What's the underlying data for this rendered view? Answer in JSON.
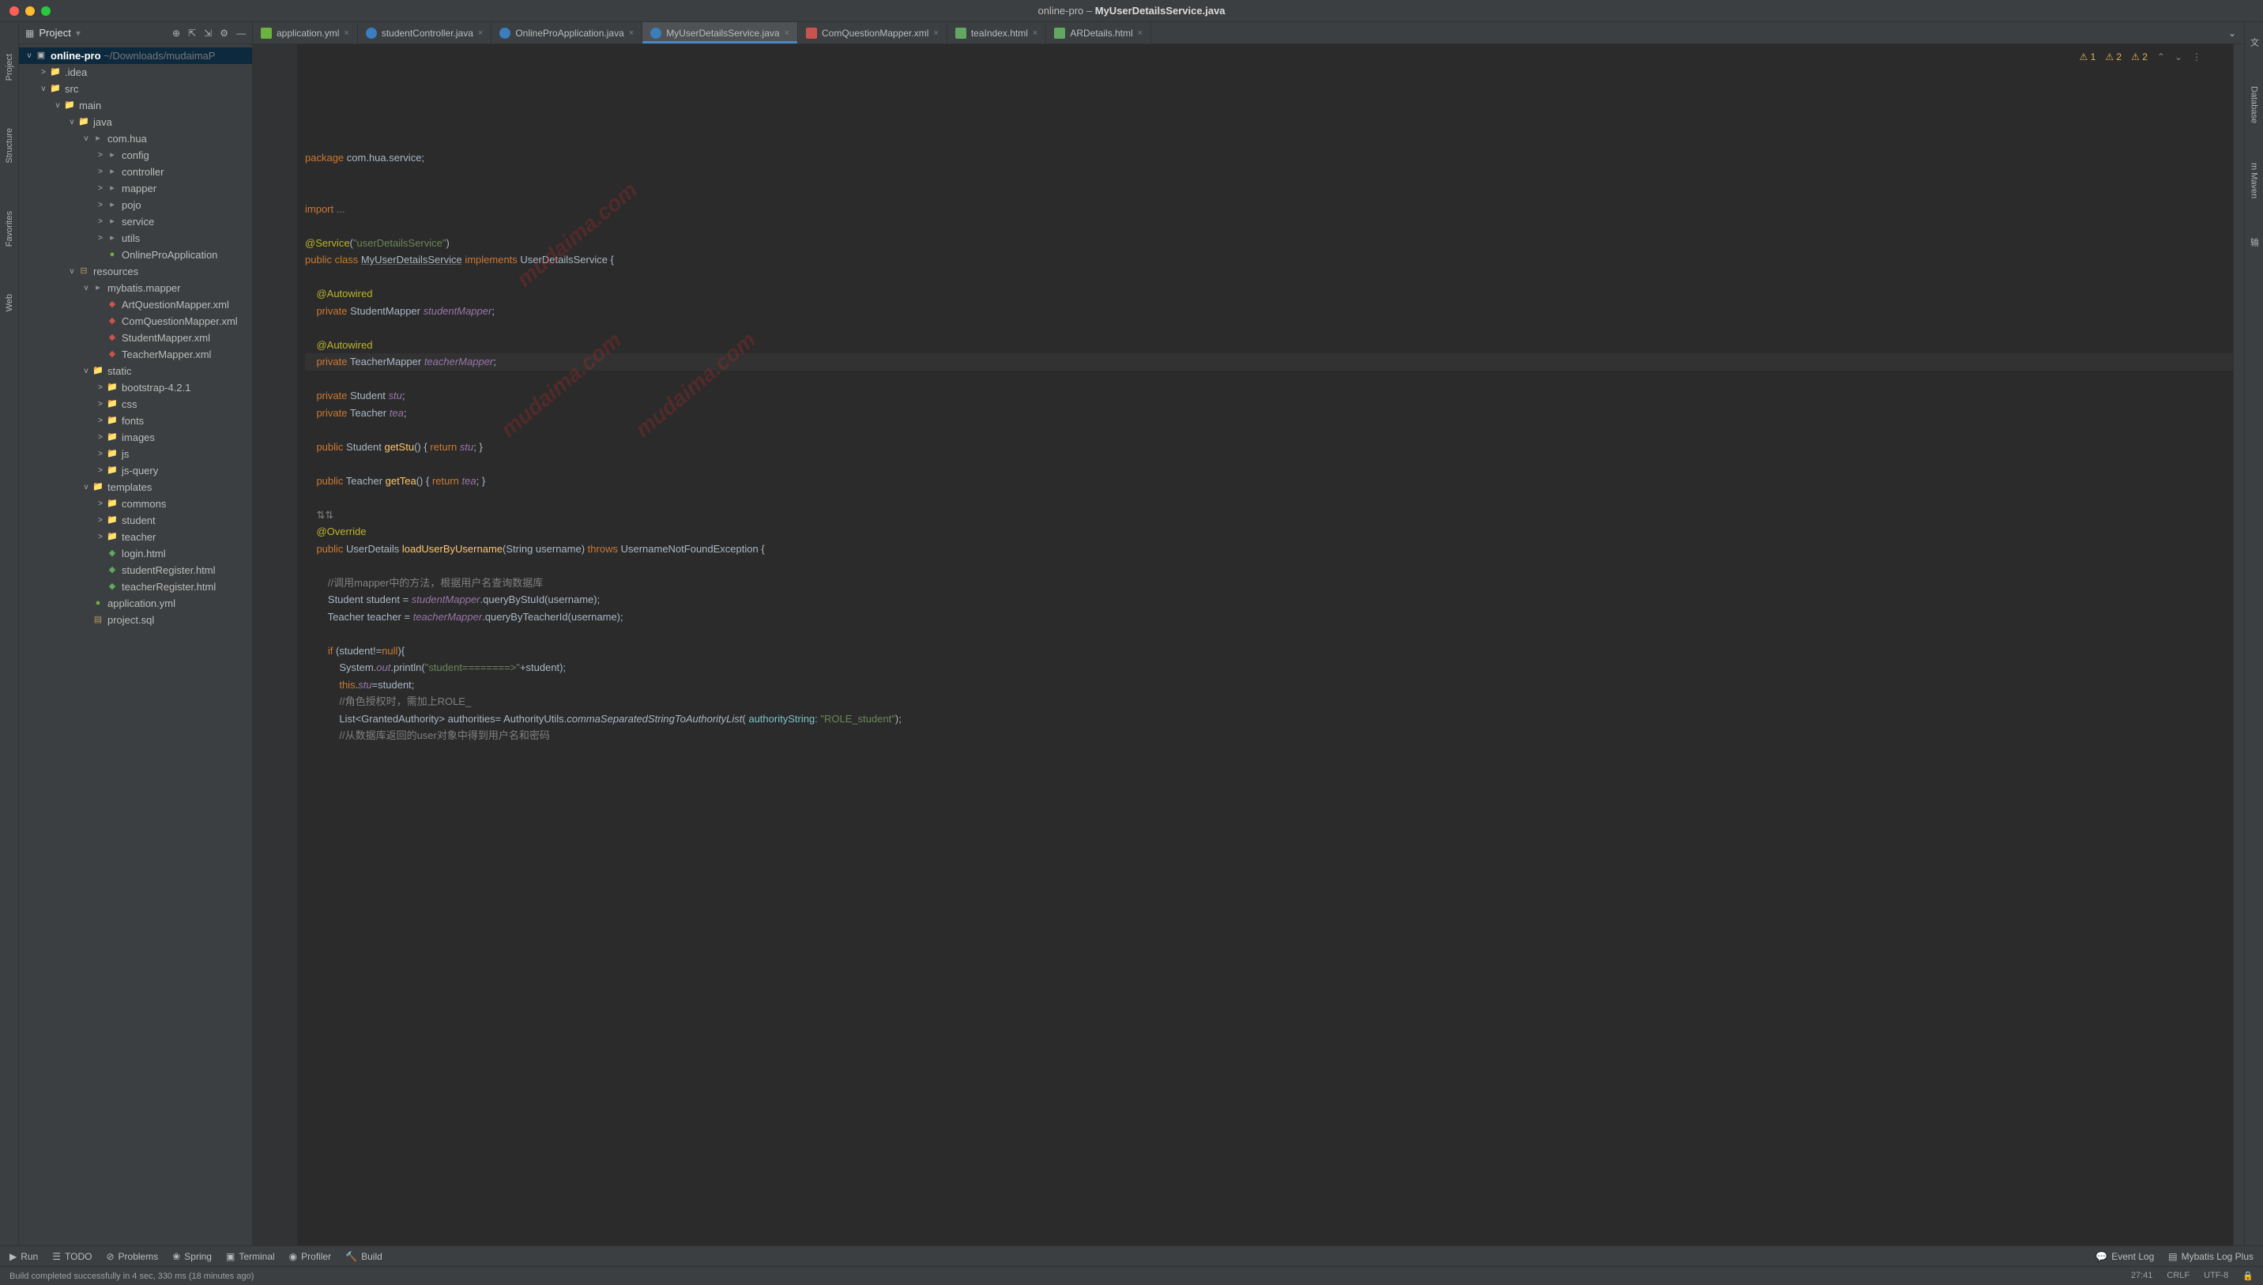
{
  "window": {
    "title_prefix": "online-pro – ",
    "title_file": "MyUserDetailsService.java"
  },
  "project_label": "Project",
  "tabs": [
    {
      "label": "application.yml",
      "type": "spring"
    },
    {
      "label": "studentController.java",
      "type": "java"
    },
    {
      "label": "OnlineProApplication.java",
      "type": "java"
    },
    {
      "label": "MyUserDetailsService.java",
      "type": "java",
      "active": true
    },
    {
      "label": "ComQuestionMapper.xml",
      "type": "xml"
    },
    {
      "label": "teaIndex.html",
      "type": "html"
    },
    {
      "label": "ARDetails.html",
      "type": "html"
    }
  ],
  "tree_root": {
    "name": "online-pro",
    "path": "~/Downloads/mudaimaP"
  },
  "tree": [
    {
      "indent": 1,
      "arr": ">",
      "ico": "dir",
      "label": ".idea"
    },
    {
      "indent": 1,
      "arr": "v",
      "ico": "blue",
      "label": "src"
    },
    {
      "indent": 2,
      "arr": "v",
      "ico": "blue",
      "label": "main"
    },
    {
      "indent": 3,
      "arr": "v",
      "ico": "blue",
      "label": "java"
    },
    {
      "indent": 4,
      "arr": "v",
      "ico": "pkg",
      "label": "com.hua"
    },
    {
      "indent": 5,
      "arr": ">",
      "ico": "pkg",
      "label": "config"
    },
    {
      "indent": 5,
      "arr": ">",
      "ico": "pkg",
      "label": "controller"
    },
    {
      "indent": 5,
      "arr": ">",
      "ico": "pkg",
      "label": "mapper"
    },
    {
      "indent": 5,
      "arr": ">",
      "ico": "pkg",
      "label": "pojo"
    },
    {
      "indent": 5,
      "arr": ">",
      "ico": "pkg",
      "label": "service"
    },
    {
      "indent": 5,
      "arr": ">",
      "ico": "pkg",
      "label": "utils"
    },
    {
      "indent": 5,
      "arr": "",
      "ico": "spring",
      "label": "OnlineProApplication"
    },
    {
      "indent": 3,
      "arr": "v",
      "ico": "res",
      "label": "resources"
    },
    {
      "indent": 4,
      "arr": "v",
      "ico": "pkg",
      "label": "mybatis.mapper"
    },
    {
      "indent": 5,
      "arr": "",
      "ico": "xml",
      "label": "ArtQuestionMapper.xml"
    },
    {
      "indent": 5,
      "arr": "",
      "ico": "xml",
      "label": "ComQuestionMapper.xml"
    },
    {
      "indent": 5,
      "arr": "",
      "ico": "xml",
      "label": "StudentMapper.xml"
    },
    {
      "indent": 5,
      "arr": "",
      "ico": "xml",
      "label": "TeacherMapper.xml"
    },
    {
      "indent": 4,
      "arr": "v",
      "ico": "dir",
      "label": "static"
    },
    {
      "indent": 5,
      "arr": ">",
      "ico": "dir",
      "label": "bootstrap-4.2.1"
    },
    {
      "indent": 5,
      "arr": ">",
      "ico": "dir",
      "label": "css"
    },
    {
      "indent": 5,
      "arr": ">",
      "ico": "dir",
      "label": "fonts"
    },
    {
      "indent": 5,
      "arr": ">",
      "ico": "dir",
      "label": "images"
    },
    {
      "indent": 5,
      "arr": ">",
      "ico": "dir",
      "label": "js"
    },
    {
      "indent": 5,
      "arr": ">",
      "ico": "dir",
      "label": "js-query"
    },
    {
      "indent": 4,
      "arr": "v",
      "ico": "dir",
      "label": "templates"
    },
    {
      "indent": 5,
      "arr": ">",
      "ico": "dir",
      "label": "commons"
    },
    {
      "indent": 5,
      "arr": ">",
      "ico": "dir",
      "label": "student"
    },
    {
      "indent": 5,
      "arr": ">",
      "ico": "dir",
      "label": "teacher"
    },
    {
      "indent": 5,
      "arr": "",
      "ico": "html",
      "label": "login.html"
    },
    {
      "indent": 5,
      "arr": "",
      "ico": "html",
      "label": "studentRegister.html"
    },
    {
      "indent": 5,
      "arr": "",
      "ico": "html",
      "label": "teacherRegister.html"
    },
    {
      "indent": 4,
      "arr": "",
      "ico": "spring",
      "label": "application.yml"
    },
    {
      "indent": 4,
      "arr": "",
      "ico": "sql",
      "label": "project.sql"
    }
  ],
  "inspections": {
    "err": "1",
    "warn": "2",
    "weak": "2"
  },
  "code_lines": [
    {
      "t": "<span class='kw'>package</span> com.hua.service;"
    },
    {
      "t": ""
    },
    {
      "t": ""
    },
    {
      "t": "<span class='kw'>import</span> <span class='cmt'>...</span>"
    },
    {
      "t": ""
    },
    {
      "t": "<span class='ann'>@Service</span>(<span class='str'>\"userDetailsService\"</span>)"
    },
    {
      "t": "<span class='kw'>public class</span> <span class='underline'>MyUserDetailsService</span> <span class='kw'>implements</span> UserDetailsService {"
    },
    {
      "t": ""
    },
    {
      "t": "    <span class='ann'>@Autowired</span>"
    },
    {
      "t": "    <span class='kw'>private</span> StudentMapper <span class='fld'>studentMapper</span>;"
    },
    {
      "t": ""
    },
    {
      "t": "    <span class='ann'>@Autowired</span>"
    },
    {
      "t": "    <span class='kw'>private</span> TeacherMapper <span class='fld'>teacherMapper</span>;",
      "caret": true
    },
    {
      "t": ""
    },
    {
      "t": "    <span class='kw'>private</span> Student <span class='fld'>stu</span>;"
    },
    {
      "t": "    <span class='kw'>private</span> Teacher <span class='fld'>tea</span>;"
    },
    {
      "t": ""
    },
    {
      "t": "    <span class='kw'>public</span> Student <span class='mtd'>getStu</span>() { <span class='kw'>return</span> <span class='fld'>stu</span>; }"
    },
    {
      "t": ""
    },
    {
      "t": "    <span class='kw'>public</span> Teacher <span class='mtd'>getTea</span>() { <span class='kw'>return</span> <span class='fld'>tea</span>; }"
    },
    {
      "t": ""
    },
    {
      "t": "    <span class='cmt'>⇅⇅</span>"
    },
    {
      "t": "    <span class='ann'>@Override</span>"
    },
    {
      "t": "    <span class='kw'>public</span> UserDetails <span class='mtd'>loadUserByUsername</span>(String username) <span class='kw'>throws</span> UsernameNotFoundException {"
    },
    {
      "t": ""
    },
    {
      "t": "        <span class='cmt'>//调用mapper中的方法，根据用户名查询数据库</span>"
    },
    {
      "t": "        Student student = <span class='fld'>studentMapper</span>.queryByStuId(username);"
    },
    {
      "t": "        Teacher teacher = <span class='fld'>teacherMapper</span>.queryByTeacherId(username);"
    },
    {
      "t": ""
    },
    {
      "t": "        <span class='kw'>if</span> (student!=<span class='kw'>null</span>){"
    },
    {
      "t": "            System.<span class='fld'>out</span>.println(<span class='str'>\"student========>\"</span>+student);"
    },
    {
      "t": "            <span class='kw'>this</span>.<span class='fld'>stu</span>=student;"
    },
    {
      "t": "            <span class='cmt'>//角色授权时，需加上ROLE_</span>"
    },
    {
      "t": "            List&lt;GrantedAuthority&gt; authorities= AuthorityUtils.<span style='font-style:italic'>commaSeparatedStringToAuthorityList</span>( <span class='param'>authorityString:</span> <span class='str'>\"ROLE_student\"</span>);"
    },
    {
      "t": "            <span class='cmt'>//从数据库返回的user对象中得到用户名和密码</span>"
    }
  ],
  "left_rail": [
    "Project",
    "Structure",
    "Favorites",
    "Web"
  ],
  "right_rail": [
    "文",
    "Database",
    "m Maven",
    "输"
  ],
  "toolwindow": {
    "left": [
      "Run",
      "TODO",
      "Problems",
      "Spring",
      "Terminal",
      "Profiler",
      "Build"
    ],
    "right": [
      "Event Log",
      "Mybatis Log Plus"
    ]
  },
  "status": {
    "msg": "Build completed successfully in 4 sec, 330 ms (18 minutes ago)",
    "right": [
      "27:41",
      "CRLF",
      "UTF-8"
    ]
  },
  "watermarks": [
    "mudaima.com",
    "mudaima.com",
    "mudaima.com"
  ]
}
